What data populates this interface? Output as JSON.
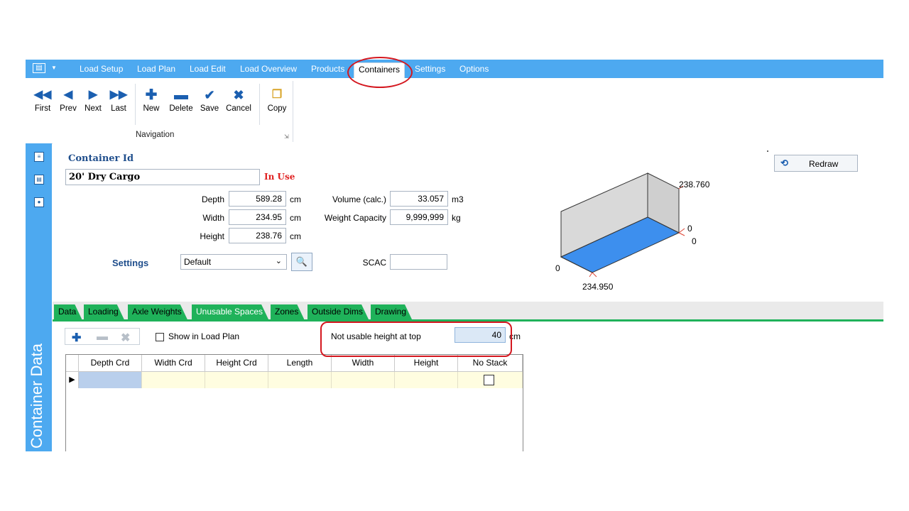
{
  "menu": {
    "app_icon": "panel-icon",
    "items": [
      "Load Setup",
      "Load Plan",
      "Load Edit",
      "Load Overview",
      "Products",
      "Containers",
      "Settings",
      "Options"
    ],
    "active": "Containers"
  },
  "ribbon": {
    "buttons": [
      {
        "label": "First",
        "icon": "first-icon"
      },
      {
        "label": "Prev",
        "icon": "prev-icon"
      },
      {
        "label": "Next",
        "icon": "next-icon"
      },
      {
        "label": "Last",
        "icon": "last-icon"
      },
      {
        "label": "New",
        "icon": "plus-icon"
      },
      {
        "label": "Delete",
        "icon": "minus-icon"
      },
      {
        "label": "Save",
        "icon": "check-icon"
      },
      {
        "label": "Cancel",
        "icon": "x-icon"
      },
      {
        "label": "Copy",
        "icon": "copy-icon"
      }
    ],
    "group_label": "Navigation"
  },
  "side": {
    "title": "Container Data"
  },
  "form": {
    "container_id_label": "Container Id",
    "container_id_value": "20' Dry Cargo",
    "status": "In Use",
    "depth_label": "Depth",
    "depth_value": "589.28",
    "depth_unit": "cm",
    "width_label": "Width",
    "width_value": "234.95",
    "width_unit": "cm",
    "height_label": "Height",
    "height_value": "238.76",
    "height_unit": "cm",
    "volume_label": "Volume (calc.)",
    "volume_value": "33.057",
    "volume_unit": "m3",
    "weight_label": "Weight Capacity",
    "weight_value": "9,999,999",
    "weight_unit": "kg",
    "settings_label": "Settings",
    "settings_value": "Default",
    "scac_label": "SCAC",
    "scac_value": "",
    "redraw_label": "Redraw"
  },
  "drawing": {
    "label_height": "238.760",
    "label_depth_a": "0",
    "label_depth_b": "0",
    "label_origin": "0",
    "label_width": "234.950",
    "wall_color": "#d9d9d9",
    "floor_color": "#3d8fee"
  },
  "tabs": [
    "Data",
    "Loading",
    "Axle Weights",
    "Unusable Spaces",
    "Zones",
    "Outside Dims",
    "Drawing"
  ],
  "active_tab": "Unusable Spaces",
  "unusable": {
    "show_in_load_plan_label": "Show in Load Plan",
    "not_usable_label": "Not usable height at top",
    "not_usable_value": "40",
    "not_usable_unit": "cm",
    "columns": [
      "Depth Crd",
      "Width Crd",
      "Height Crd",
      "Length",
      "Width",
      "Height",
      "No Stack"
    ]
  },
  "colors": {
    "menu_bar": "#4da9f0",
    "tab_green": "#1fb25a",
    "highlight_red": "#d4171f"
  }
}
